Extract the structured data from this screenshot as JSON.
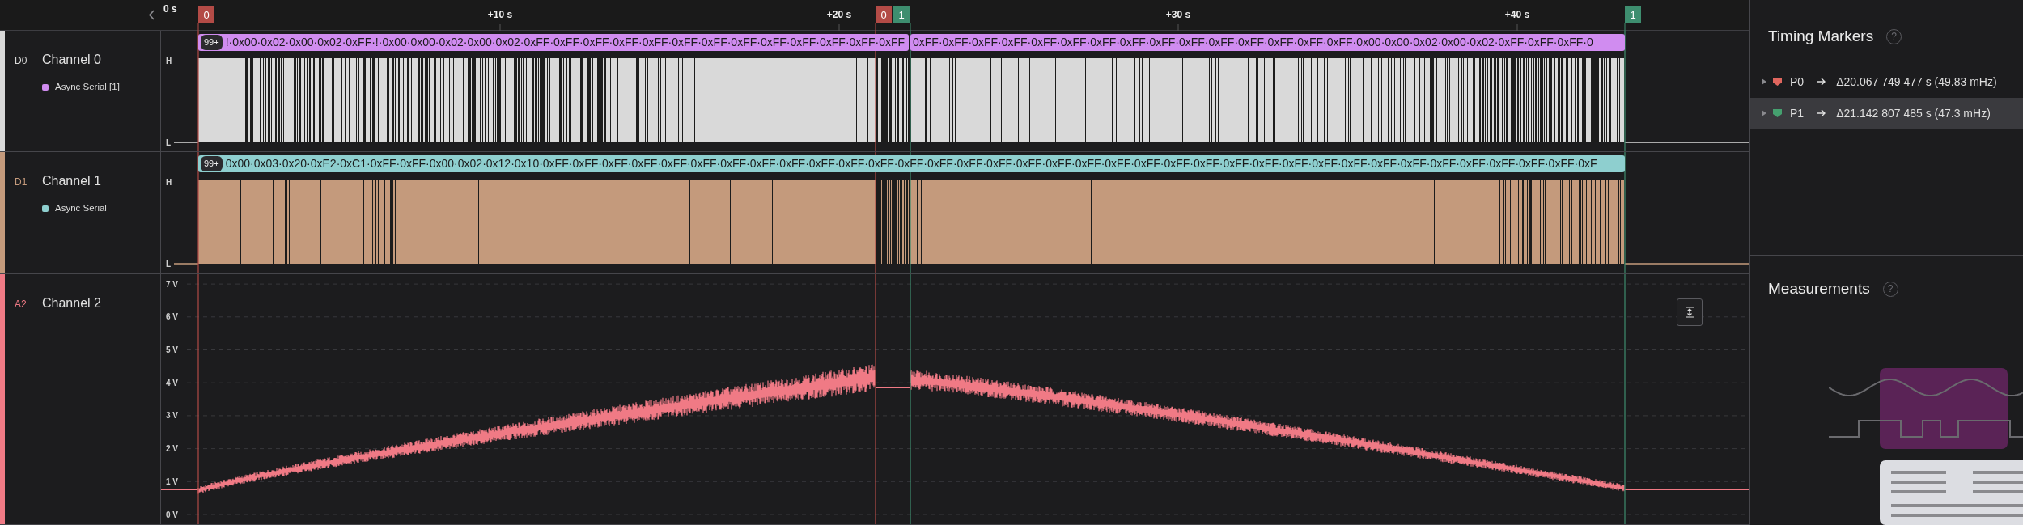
{
  "ruler": {
    "start_label": "0 s",
    "ticks": [
      "+10 s",
      "+20 s",
      "+30 s",
      "+40 s"
    ]
  },
  "markers": [
    {
      "label": "0",
      "color": "#b34b46"
    },
    {
      "label": "0",
      "color": "#b34b46"
    },
    {
      "label": "1",
      "color": "#3e8e6f"
    },
    {
      "label": "1",
      "color": "#3e8e6f"
    }
  ],
  "channels": [
    {
      "kind": "digital",
      "id": "D0",
      "name": "Channel 0",
      "color": "#d9d9d9",
      "analyzer": {
        "name": "Async Serial [1]",
        "color": "#d08cf0"
      },
      "levels": [
        "H",
        "L"
      ],
      "protocol": {
        "badge": "99+",
        "segments": [
          "!·0x00·0x02·0x00·0x02·0xFF·!·0x00·0x00·0x02·0x00·0x02·0xFF·0xFF·0xFF·0xFF·0xFF·0xFF·0xFF·0xFF·0xFF·0xFF·0xFF·0xFF·0xFF",
          "0xFF·0xFF·0xFF·0xFF·0xFF·0xFF·0xFF·0xFF·0xFF·0xFF·0xFF·0xFF·0xFF·0xFF·0xFF·0x00·0x00·0x02·0x00·0x02·0xFF·0xFF·0xFF·0"
        ]
      }
    },
    {
      "kind": "digital",
      "id": "D1",
      "name": "Channel 1",
      "color": "#c49a7c",
      "analyzer": {
        "name": "Async Serial",
        "color": "#8ecfcf"
      },
      "levels": [
        "H",
        "L"
      ],
      "protocol": {
        "badge": "99+",
        "segments": [
          "0x00·0x03·0x20·0xE2·0xC1·0xFF·0xFF·0x00·0x02·0x12·0x10·0xFF·0xFF·0xFF·0xFF·0xFF·0xFF·0xFF·0xFF·0xFF·0xFF·0xFF·0xFF·0xFF·0xFF·0xFF·0xFF·0xFF·0xFF·0xFF·0xFF·0xFF·0xFF·0xFF·0xFF·0xFF·0xFF·0xFF·0xFF·0xFF·0xFF·0xFF·0xFF·0xFF·0xFF·0xFF·0xF"
        ]
      }
    },
    {
      "kind": "analog",
      "id": "A2",
      "name": "Channel 2",
      "color": "#f07a85",
      "voltage_ticks": [
        "7 V",
        "6 V",
        "5 V",
        "4 V",
        "3 V",
        "2 V",
        "1 V",
        "0 V"
      ]
    }
  ],
  "timing_markers": {
    "title": "Timing Markers",
    "help": "?",
    "pairs": [
      {
        "label": "P0",
        "color": "#e0665e",
        "delta": "Δ20.067 749 477 s (49.83 mHz)",
        "expanded": false,
        "selected": false
      },
      {
        "label": "P1",
        "color": "#45a06f",
        "delta": "Δ21.142 807 485 s (47.3 mHz)",
        "expanded": false,
        "selected": true
      }
    ]
  },
  "measurements": {
    "title": "Measurements",
    "help": "?"
  }
}
